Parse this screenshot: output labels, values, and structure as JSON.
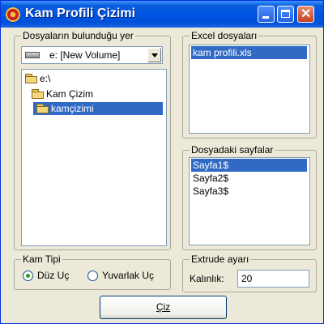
{
  "window": {
    "title": "Kam Profili Çizimi"
  },
  "titlebar": {
    "close_glyph": "✕"
  },
  "folders_group": {
    "label": "Dosyaların bulunduğu yer",
    "drive_select": {
      "value": "e: [New Volume]"
    },
    "tree": [
      {
        "label": "e:\\"
      },
      {
        "label": "Kam Çizim"
      },
      {
        "label": "kamçizimi",
        "selected": true
      }
    ]
  },
  "excel_group": {
    "label": "Excel dosyaları",
    "files": [
      "kam profili.xls"
    ]
  },
  "sheets_group": {
    "label": "Dosyadaki sayfalar",
    "sheets": [
      "Sayfa1$",
      "Sayfa2$",
      "Sayfa3$"
    ]
  },
  "kam_tipi": {
    "label": "Kam Tipi",
    "options": [
      {
        "label": "Düz Uç",
        "checked": true
      },
      {
        "label": "Yuvarlak Uç",
        "checked": false
      }
    ]
  },
  "extrude": {
    "label": "Extrude ayarı",
    "field_label": "Kalınlık:",
    "value": "20"
  },
  "draw_button": {
    "label": "Çiz"
  },
  "colors": {
    "selection": "#316ac5",
    "titlebar": "#0054e3",
    "face": "#ece9d8"
  }
}
